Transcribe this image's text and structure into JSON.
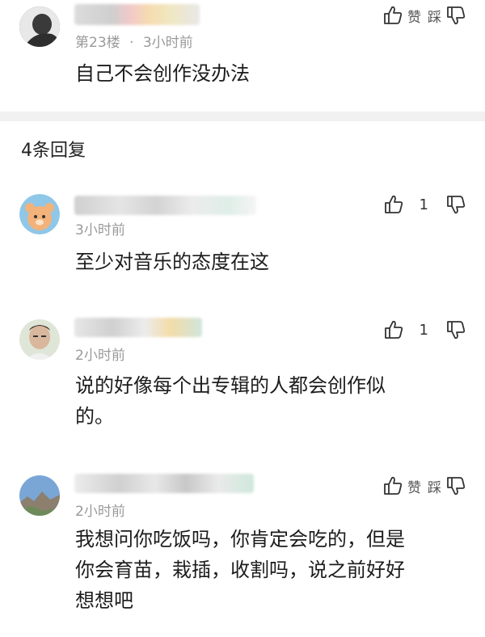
{
  "top_comment": {
    "floor": "第23楼",
    "time": "3小时前",
    "text": "自己不会创作没办法",
    "like_label": "赞",
    "dislike_label": "踩"
  },
  "replies_header": "4条回复",
  "replies": [
    {
      "time": "3小时前",
      "text": "至少对音乐的态度在这",
      "likes": "1"
    },
    {
      "time": "2小时前",
      "text_line1": "说的好像每个出专辑的人都会创作似",
      "text_line2": "的。",
      "likes": "1"
    },
    {
      "time": "2小时前",
      "text_line1": "我想问你吃饭吗，你肯定会吃的，但是",
      "text_line2": "你会育苗，栽插，收割吗，说之前好好",
      "text_line3": "想想吧",
      "like_label": "赞",
      "dislike_label": "踩"
    }
  ],
  "separator": "·",
  "colors": {
    "meta": "#9a9a9a",
    "divider": "#f1f1f1",
    "text": "#1c1c1c"
  },
  "icons": [
    "thumbs-up-icon",
    "thumbs-down-icon"
  ]
}
